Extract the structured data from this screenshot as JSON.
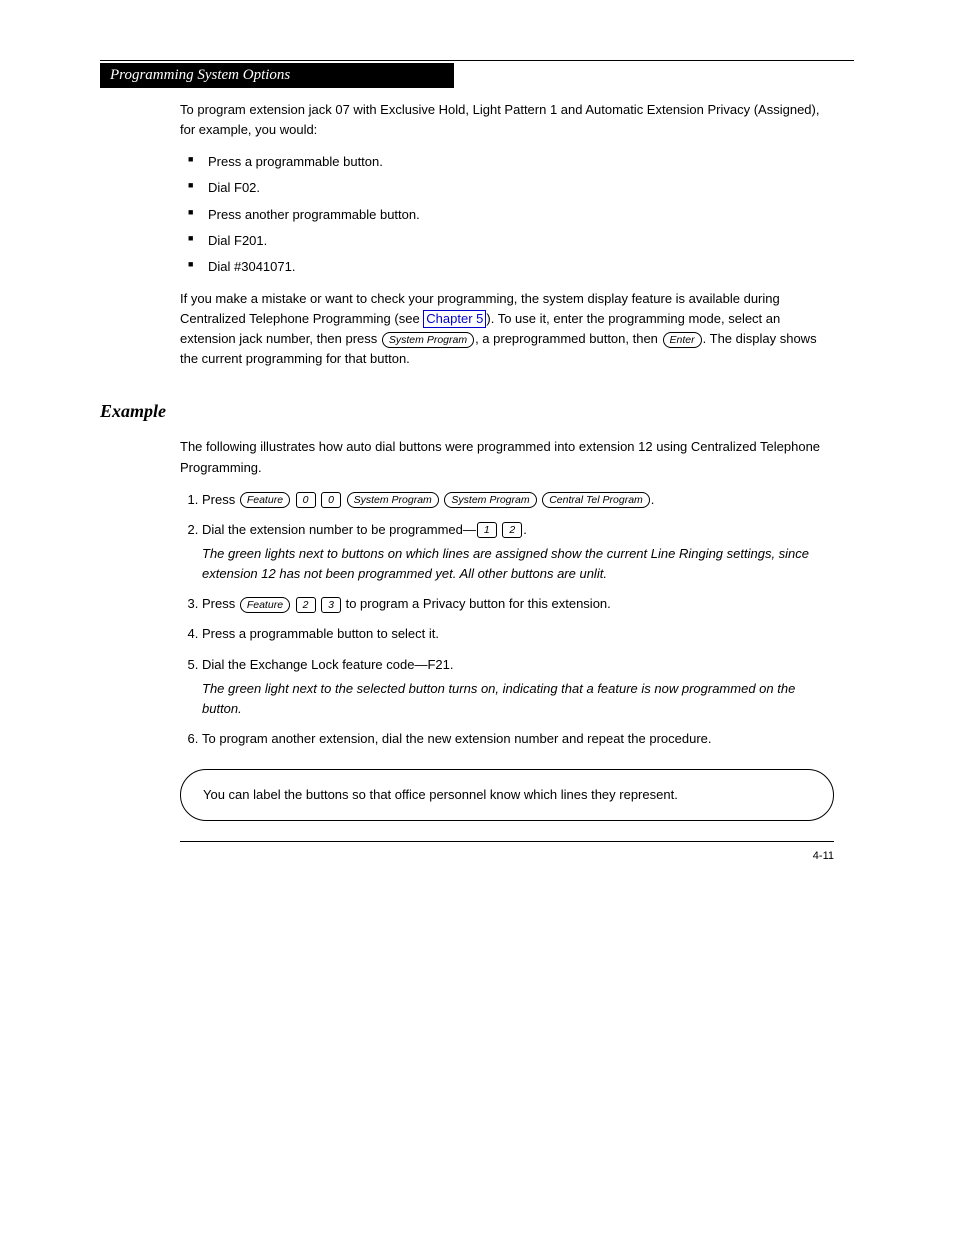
{
  "header": {
    "title": "Programming System Options"
  },
  "intro": {
    "p1": "To program extension jack 07 with Exclusive Hold, Light Pattern 1 and Automatic Extension Privacy (Assigned), for example, you would:"
  },
  "bullets": [
    "Press a programmable button.",
    "Dial F02.",
    "Press another programmable button.",
    "Dial F201.",
    "Dial #3041071."
  ],
  "intro2": "If you make a mistake or want to check your programming, the system display feature is available during Centralized Telephone Programming (see",
  "intro2_link": "Chapter 5",
  "intro2_tail": "). To use it, enter the programming mode, select an extension jack number, then press ",
  "intro2_mid": ", a preprogrammed button, then ",
  "intro2_end": ". The display shows the current programming for that button.",
  "section": {
    "title": "Example"
  },
  "example_intro": "The following illustrates how auto dial buttons were programmed into extension 12 using Centralized Telephone Programming.",
  "steps": {
    "s1": "Press ",
    "s1_end": ".",
    "s2a": "Dial the extension number to be programmed—",
    "s2a_end": ".",
    "s2b": "The green lights next to buttons on which lines are assigned show the current Line Ringing settings, since extension 12 has not been programmed yet. All other buttons are unlit.",
    "s3": "Press ",
    "s3_end": " to program a Privacy button for this extension.",
    "s4": "Press a programmable button to select it.",
    "s5a": "Dial the Exchange Lock feature code—F21.",
    "s5b": "The green light next to the selected button turns on, indicating that a feature is now programmed on the button.",
    "s6": "To program another extension, dial the new extension number and repeat the procedure."
  },
  "callout": {
    "text": "You can label the buttons so that office personnel know which lines they represent."
  },
  "footer": {
    "page": "4-11"
  },
  "keys": {
    "feature": "Feature",
    "system_program": "System Program",
    "enter": "Enter",
    "central_tel_program": "Central Tel Program",
    "d0": "0",
    "d1": "1",
    "d2": "2",
    "d3": "3"
  }
}
